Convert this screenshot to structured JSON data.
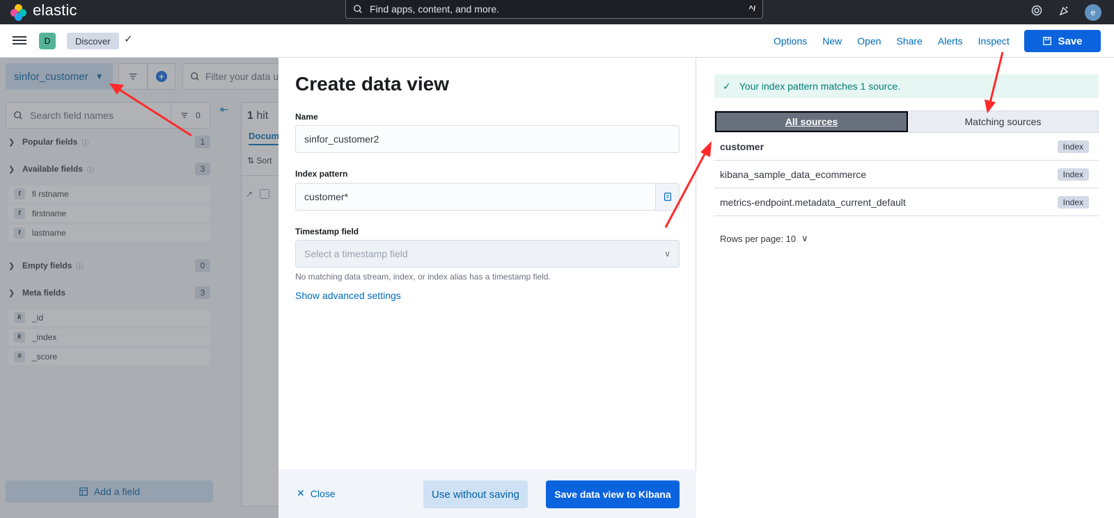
{
  "topbar": {
    "logo": "elastic",
    "search_placeholder": "Find apps, content, and more.",
    "search_shortcut": "^/",
    "avatar": "e"
  },
  "subbar": {
    "app_badge": "D",
    "breadcrumb": "Discover",
    "links": [
      "Options",
      "New",
      "Open",
      "Share",
      "Alerts",
      "Inspect"
    ],
    "save": "Save"
  },
  "discover": {
    "data_view": "sinfor_customer",
    "query_placeholder": "Filter your data u",
    "field_search_placeholder": "Search field names",
    "filter_count": "0",
    "sections": {
      "popular": {
        "label": "Popular fields",
        "count": "1"
      },
      "available": {
        "label": "Available fields",
        "count": "3"
      },
      "empty": {
        "label": "Empty fields",
        "count": "0"
      },
      "meta": {
        "label": "Meta fields",
        "count": "3"
      }
    },
    "available_fields": [
      {
        "type": "t",
        "name": "fi rstname"
      },
      {
        "type": "t",
        "name": "firstname"
      },
      {
        "type": "t",
        "name": "lastname"
      }
    ],
    "meta_fields": [
      {
        "type": "k",
        "name": "_id"
      },
      {
        "type": "k",
        "name": "_index"
      },
      {
        "type": "#",
        "name": "_score"
      }
    ],
    "add_field": "Add a field",
    "hits_count": "1",
    "hits_label": "hit",
    "documents_tab": "Docume",
    "sort_label": "Sort"
  },
  "flyout": {
    "title": "Create data view",
    "name_label": "Name",
    "name_value": "sinfor_customer2",
    "index_label": "Index pattern",
    "index_value": "customer*",
    "timestamp_label": "Timestamp field",
    "timestamp_placeholder": "Select a timestamp field",
    "timestamp_help": "No matching data stream, index, or index alias has a timestamp field.",
    "advanced_link": "Show advanced settings",
    "close": "Close",
    "use_without_saving": "Use without saving",
    "save_to_kibana": "Save data view to Kibana",
    "callout": "Your index pattern matches 1 source.",
    "tab_all": "All sources",
    "tab_matching": "Matching sources",
    "sources": [
      {
        "name": "customer",
        "badge": "Index"
      },
      {
        "name": "kibana_sample_data_ecommerce",
        "badge": "Index"
      },
      {
        "name": "metrics-endpoint.metadata_current_default",
        "badge": "Index"
      }
    ],
    "rows_per_page": "Rows per page: 10"
  },
  "colors": {
    "primary": "#0b64dd",
    "link": "#006bb8",
    "success_bg": "#e6f6f3",
    "success_text": "#017d73",
    "header_bg": "#25282f",
    "annotation": "#ff2a2a"
  }
}
